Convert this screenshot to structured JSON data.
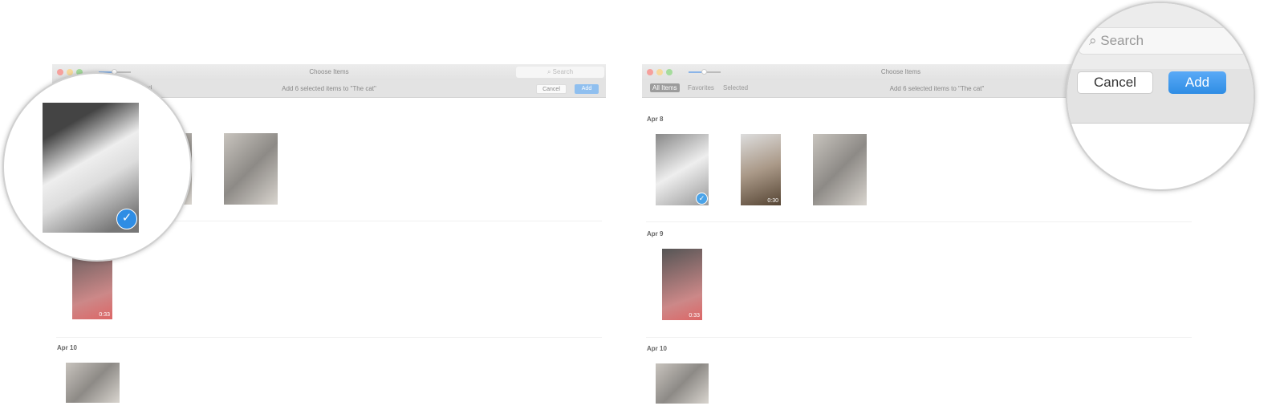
{
  "window_title": "Choose Items",
  "search_placeholder": "Search",
  "subtitle": "Add 6 selected items to \"The cat\"",
  "cancel_label": "Cancel",
  "add_label": "Add",
  "tabs": [
    {
      "label": "All Items",
      "active": true
    },
    {
      "label": "Favorites"
    },
    {
      "label": "Selected"
    }
  ],
  "left_partial_tab": "lected",
  "sections": [
    {
      "date": "Apr 8",
      "items": [
        {
          "selected": true
        },
        {
          "duration": "0:30"
        },
        {}
      ]
    },
    {
      "date": "Apr 9",
      "items": [
        {
          "duration": "0:33"
        }
      ]
    },
    {
      "date": "Apr 10",
      "items": [
        {}
      ]
    }
  ],
  "colors": {
    "accent": "#2f8de4",
    "close": "#f2605a",
    "minimize": "#f5be4f",
    "zoom": "#5fc451"
  }
}
